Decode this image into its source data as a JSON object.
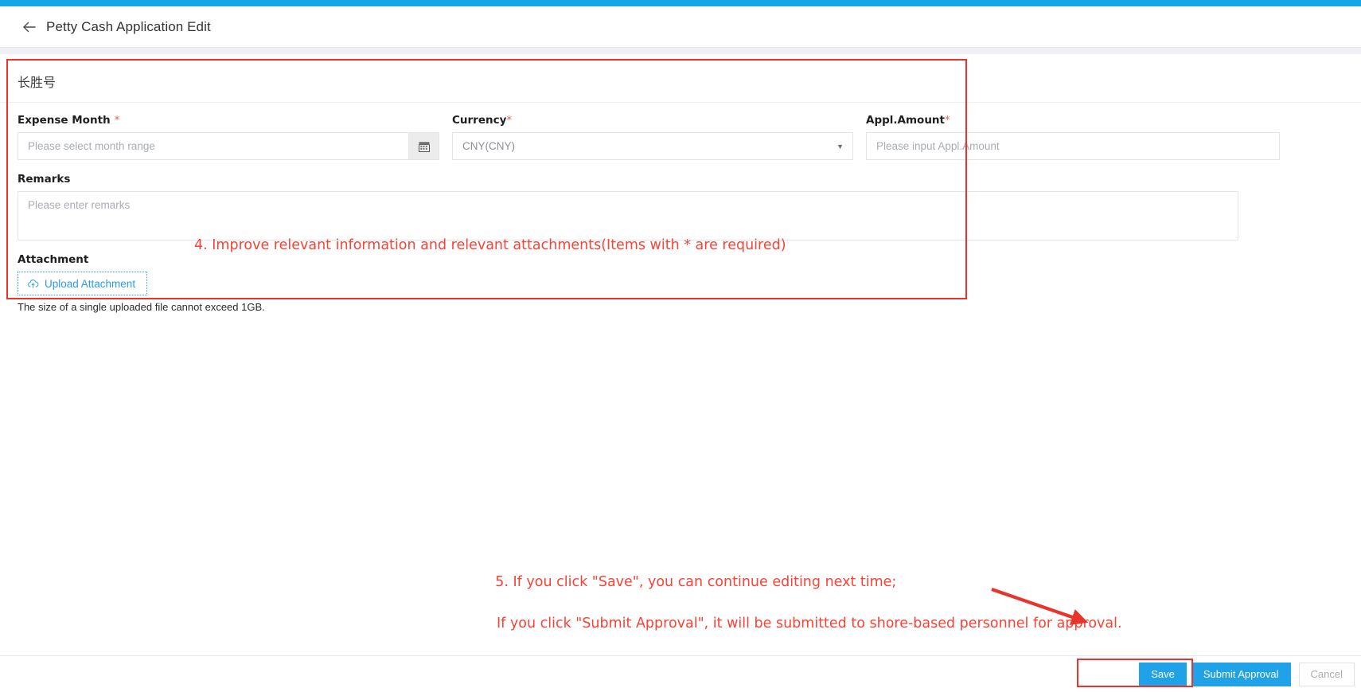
{
  "header": {
    "back_icon": "arrow-left-icon",
    "title": "Petty Cash Application Edit"
  },
  "form": {
    "card_title": "长胜号",
    "expense_month": {
      "label": "Expense Month",
      "required_mark": "*",
      "placeholder": "Please select month range",
      "value": "",
      "addon_icon": "calendar-icon"
    },
    "currency": {
      "label": "Currency",
      "required_mark": "*",
      "value": "CNY(CNY)",
      "caret_icon": "chevron-down-icon"
    },
    "appl_amount": {
      "label": "Appl.Amount",
      "required_mark": "*",
      "placeholder": "Please input Appl.Amount",
      "value": ""
    },
    "remarks": {
      "label": "Remarks",
      "placeholder": "Please enter remarks",
      "value": ""
    },
    "attachment": {
      "label": "Attachment",
      "upload_icon": "cloud-upload-icon",
      "upload_label": "Upload Attachment",
      "hint": "The size of a single uploaded file cannot exceed 1GB."
    }
  },
  "footer": {
    "save_label": "Save",
    "submit_label": "Submit Approval",
    "cancel_label": "Cancel"
  },
  "annotations": {
    "step4": "4. Improve relevant information and relevant attachments(Items with * are required)",
    "step5_line1": "5. If you click \"Save\", you can continue editing next time;",
    "step5_line2": "If you click \"Submit Approval\", it will be submitted to shore-based personnel for approval."
  },
  "colors": {
    "accent": "#13a6e8",
    "primary_button": "#1fa2e8",
    "annotation_red": "#fc4135",
    "required_star": "#e8604c"
  }
}
